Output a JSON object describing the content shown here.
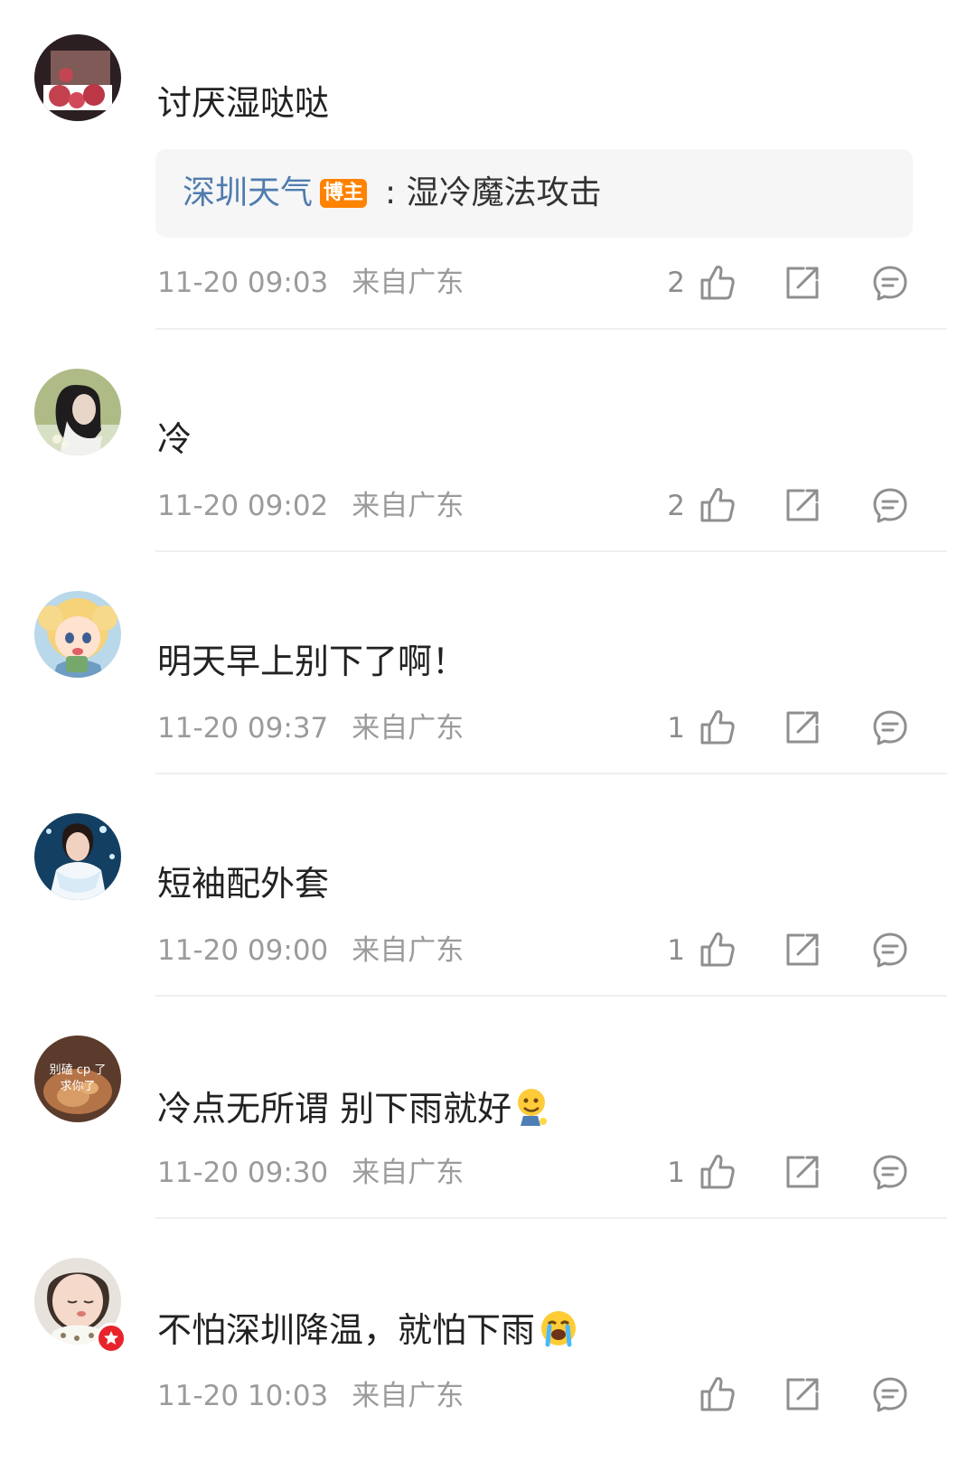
{
  "comments": [
    {
      "text": "讨厌湿哒哒",
      "reply": {
        "user": "深圳天气",
        "tag": "博主",
        "text": ": 湿冷魔法攻击"
      },
      "time": "11-20 09:03",
      "location": "来自广东",
      "likes": "2"
    },
    {
      "text": "冷",
      "time": "11-20 09:02",
      "location": "来自广东",
      "likes": "2"
    },
    {
      "text": "明天早上别下了啊！",
      "time": "11-20 09:37",
      "location": "来自广东",
      "likes": "1"
    },
    {
      "text": "短袖配外套",
      "time": "11-20 09:00",
      "location": "来自广东",
      "likes": "1"
    },
    {
      "text": "冷点无所谓 别下雨就好",
      "avatar_text": "别磕 cp 了\n求你了",
      "time": "11-20 09:30",
      "location": "来自广东",
      "likes": "1"
    },
    {
      "text": "不怕深圳降温，就怕下雨",
      "time": "11-20 10:03",
      "location": "来自广东",
      "likes": ""
    }
  ],
  "icons": {
    "like": "thumbs-up-icon",
    "share": "share-icon",
    "comment": "comment-icon"
  },
  "colors": {
    "username_link": "#4f7cad",
    "blogger_tag": "#ff8200",
    "meta_text": "#9b9b9b",
    "verified_badge": "#e8232b"
  }
}
